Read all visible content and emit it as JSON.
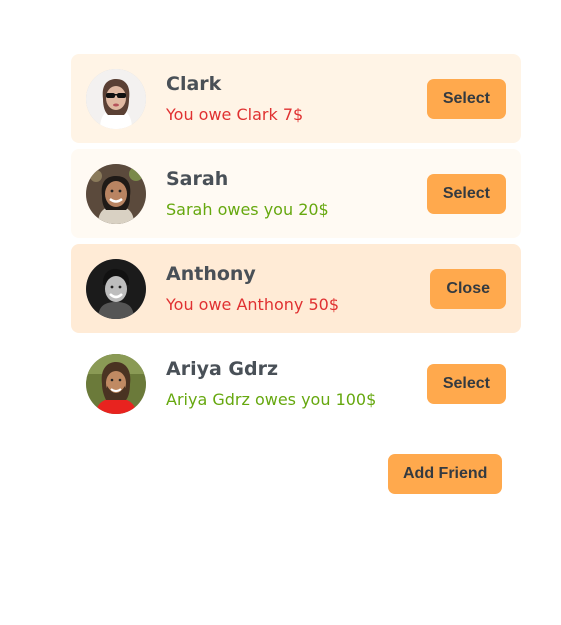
{
  "friends": [
    {
      "name": "Clark",
      "status": "You owe Clark 7$",
      "status_type": "owe",
      "button_label": "Select",
      "avatar_colors": {
        "bg": "#f3f1f0",
        "skin": "#e0b9a2",
        "hair": "#5a4034",
        "shirt": "#ffffff"
      }
    },
    {
      "name": "Sarah",
      "status": "Sarah owes you 20$",
      "status_type": "owed",
      "button_label": "Select",
      "avatar_colors": {
        "bg": "#5b4a3c",
        "skin": "#b98462",
        "hair": "#1f1a17",
        "shirt": "#d9d1c3"
      }
    },
    {
      "name": "Anthony",
      "status": "You owe Anthony 50$",
      "status_type": "owe",
      "button_label": "Close",
      "avatar_colors": {
        "bg": "#1b1b1b",
        "skin": "#bdbdbd",
        "hair": "#111111",
        "shirt": "#555555"
      }
    },
    {
      "name": "Ariya Gdrz",
      "status": "Ariya Gdrz owes you 100$",
      "status_type": "owed",
      "button_label": "Select",
      "avatar_colors": {
        "bg": "#6b7a3a",
        "skin": "#c08a63",
        "hair": "#4a3322",
        "shirt": "#e8231f"
      }
    }
  ],
  "add_friend_label": "Add Friend",
  "colors": {
    "accent": "#ffa94d",
    "owe": "#e03131",
    "owed": "#66a80f"
  }
}
